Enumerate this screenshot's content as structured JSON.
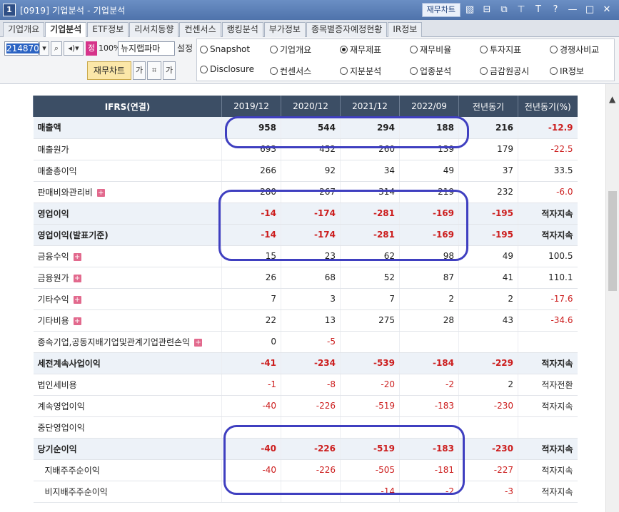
{
  "window": {
    "number": "1",
    "title": "[0919] 기업분석 - 기업분석",
    "right_button": "재무차트"
  },
  "tabs": [
    "기업개요",
    "기업분석",
    "ETF정보",
    "리서치동향",
    "컨센서스",
    "랭킹분석",
    "부가정보",
    "종목별증자예정현황",
    "IR정보"
  ],
  "toolbar": {
    "code": "214870",
    "jeong": "정",
    "pct": "100%",
    "stock_name": "뉴지랩파마",
    "setting": "설정",
    "chart_button": "재무차트",
    "radio_options": [
      "Snapshot",
      "기업개요",
      "재무제표",
      "재무비율",
      "투자지표",
      "경쟁사비교",
      "Disclosure",
      "컨센서스",
      "지분분석",
      "업종분석",
      "금감원공시",
      "IR정보"
    ],
    "radio_selected": "재무제표"
  },
  "table": {
    "header": {
      "label": "IFRS(연결)",
      "cols": [
        "2019/12",
        "2020/12",
        "2021/12",
        "2022/09",
        "전년동기",
        "전년동기(%)"
      ]
    },
    "rows": [
      {
        "label": "매출액",
        "vals": [
          "958",
          "544",
          "294",
          "188",
          "216",
          "-12.9"
        ]
      },
      {
        "label": "매출원가",
        "vals": [
          "693",
          "452",
          "260",
          "139",
          "179",
          "-22.5"
        ]
      },
      {
        "label": "매출총이익",
        "vals": [
          "266",
          "92",
          "34",
          "49",
          "37",
          "33.5"
        ]
      },
      {
        "label": "판매비와관리비",
        "vals": [
          "280",
          "267",
          "314",
          "219",
          "232",
          "-6.0"
        ]
      },
      {
        "label": "영업이익",
        "vals": [
          "-14",
          "-174",
          "-281",
          "-169",
          "-195",
          "적자지속"
        ]
      },
      {
        "label": "영업이익(발표기준)",
        "vals": [
          "-14",
          "-174",
          "-281",
          "-169",
          "-195",
          "적자지속"
        ]
      },
      {
        "label": "금융수익",
        "vals": [
          "15",
          "23",
          "62",
          "98",
          "49",
          "100.5"
        ]
      },
      {
        "label": "금융원가",
        "vals": [
          "26",
          "68",
          "52",
          "87",
          "41",
          "110.1"
        ]
      },
      {
        "label": "기타수익",
        "vals": [
          "7",
          "3",
          "7",
          "2",
          "2",
          "-17.6"
        ]
      },
      {
        "label": "기타비용",
        "vals": [
          "22",
          "13",
          "275",
          "28",
          "43",
          "-34.6"
        ]
      },
      {
        "label": "종속기업,공동지배기업및관계기업관련손익",
        "vals": [
          "0",
          "-5",
          "",
          "",
          "",
          ""
        ]
      },
      {
        "label": "세전계속사업이익",
        "vals": [
          "-41",
          "-234",
          "-539",
          "-184",
          "-229",
          "적자지속"
        ]
      },
      {
        "label": "법인세비용",
        "vals": [
          "-1",
          "-8",
          "-20",
          "-2",
          "2",
          "적자전환"
        ]
      },
      {
        "label": "계속영업이익",
        "vals": [
          "-40",
          "-226",
          "-519",
          "-183",
          "-230",
          "적자지속"
        ]
      },
      {
        "label": "중단영업이익",
        "vals": [
          "",
          "",
          "",
          "",
          "",
          ""
        ]
      },
      {
        "label": "당기순이익",
        "vals": [
          "-40",
          "-226",
          "-519",
          "-183",
          "-230",
          "적자지속"
        ]
      },
      {
        "label": "지배주주순이익",
        "vals": [
          "-40",
          "-226",
          "-505",
          "-181",
          "-227",
          "적자지속"
        ]
      },
      {
        "label": "비지배주주순이익",
        "vals": [
          "",
          "",
          "-14",
          "-2",
          "-3",
          "적자지속"
        ]
      }
    ]
  }
}
